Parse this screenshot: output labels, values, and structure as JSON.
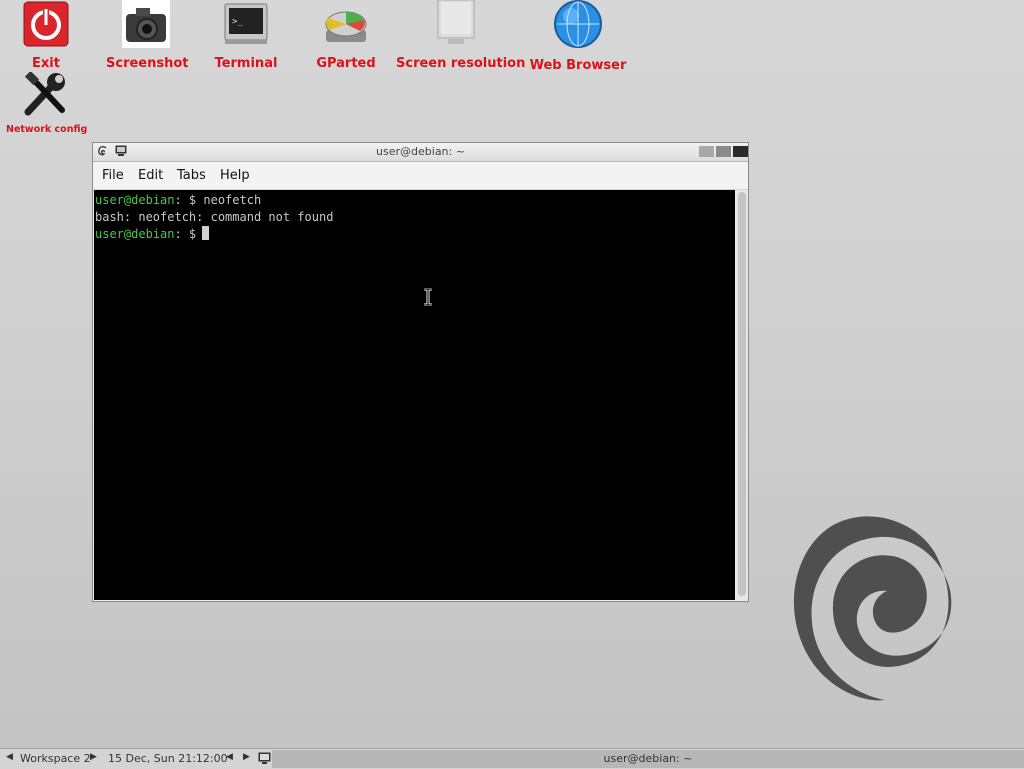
{
  "desktop": {
    "icons": [
      {
        "label": "Exit",
        "icon": "power-icon"
      },
      {
        "label": "Screenshot",
        "icon": "camera-icon"
      },
      {
        "label": "Terminal",
        "icon": "terminal-icon"
      },
      {
        "label": "GParted",
        "icon": "disk-icon"
      },
      {
        "label": "Screen resolution",
        "icon": "monitor-icon"
      },
      {
        "label": "Web Browser",
        "icon": "globe-icon"
      },
      {
        "label": "Network config",
        "icon": "tools-icon"
      }
    ]
  },
  "window": {
    "title": "user@debian: ~",
    "menu": [
      "File",
      "Edit",
      "Tabs",
      "Help"
    ]
  },
  "terminal": {
    "lines": [
      {
        "prompt": "user@debian",
        "rest": ": $ neofetch"
      },
      {
        "text": "bash: neofetch: command not found"
      },
      {
        "prompt": "user@debian",
        "rest": ": $"
      }
    ]
  },
  "taskbar": {
    "workspace": "Workspace 2",
    "clock": "15 Dec, Sun 21:12:00",
    "task_title": "user@debian: ~"
  },
  "colors": {
    "icon_label": "#d9121b",
    "prompt_green": "#4cc64c",
    "terminal_bg": "#000000"
  }
}
